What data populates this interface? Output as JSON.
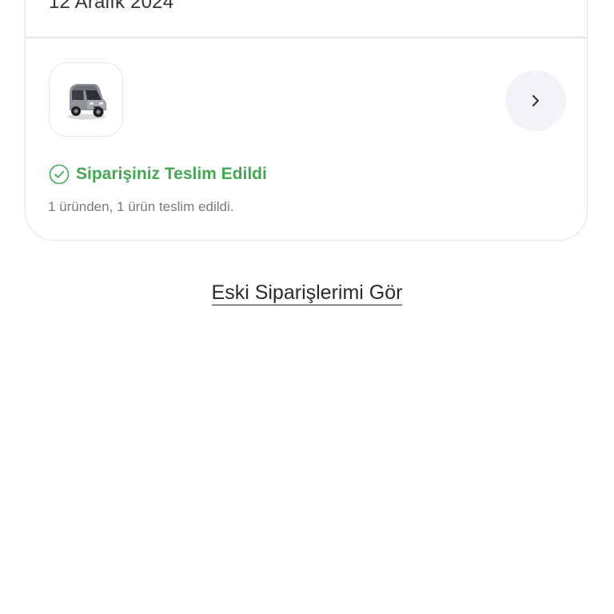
{
  "order": {
    "date": "12 Aralık 2024",
    "product_image": "electric-microcar",
    "status": {
      "icon": "check-circle-icon",
      "color": "#45a853",
      "title": "Siparişiniz Teslim Edildi",
      "detail": "1 üründen, 1 ürün teslim edildi."
    },
    "detail_icon": "chevron-right-icon"
  },
  "footer": {
    "old_orders_link": "Eski Siparişlerimi Gör"
  }
}
